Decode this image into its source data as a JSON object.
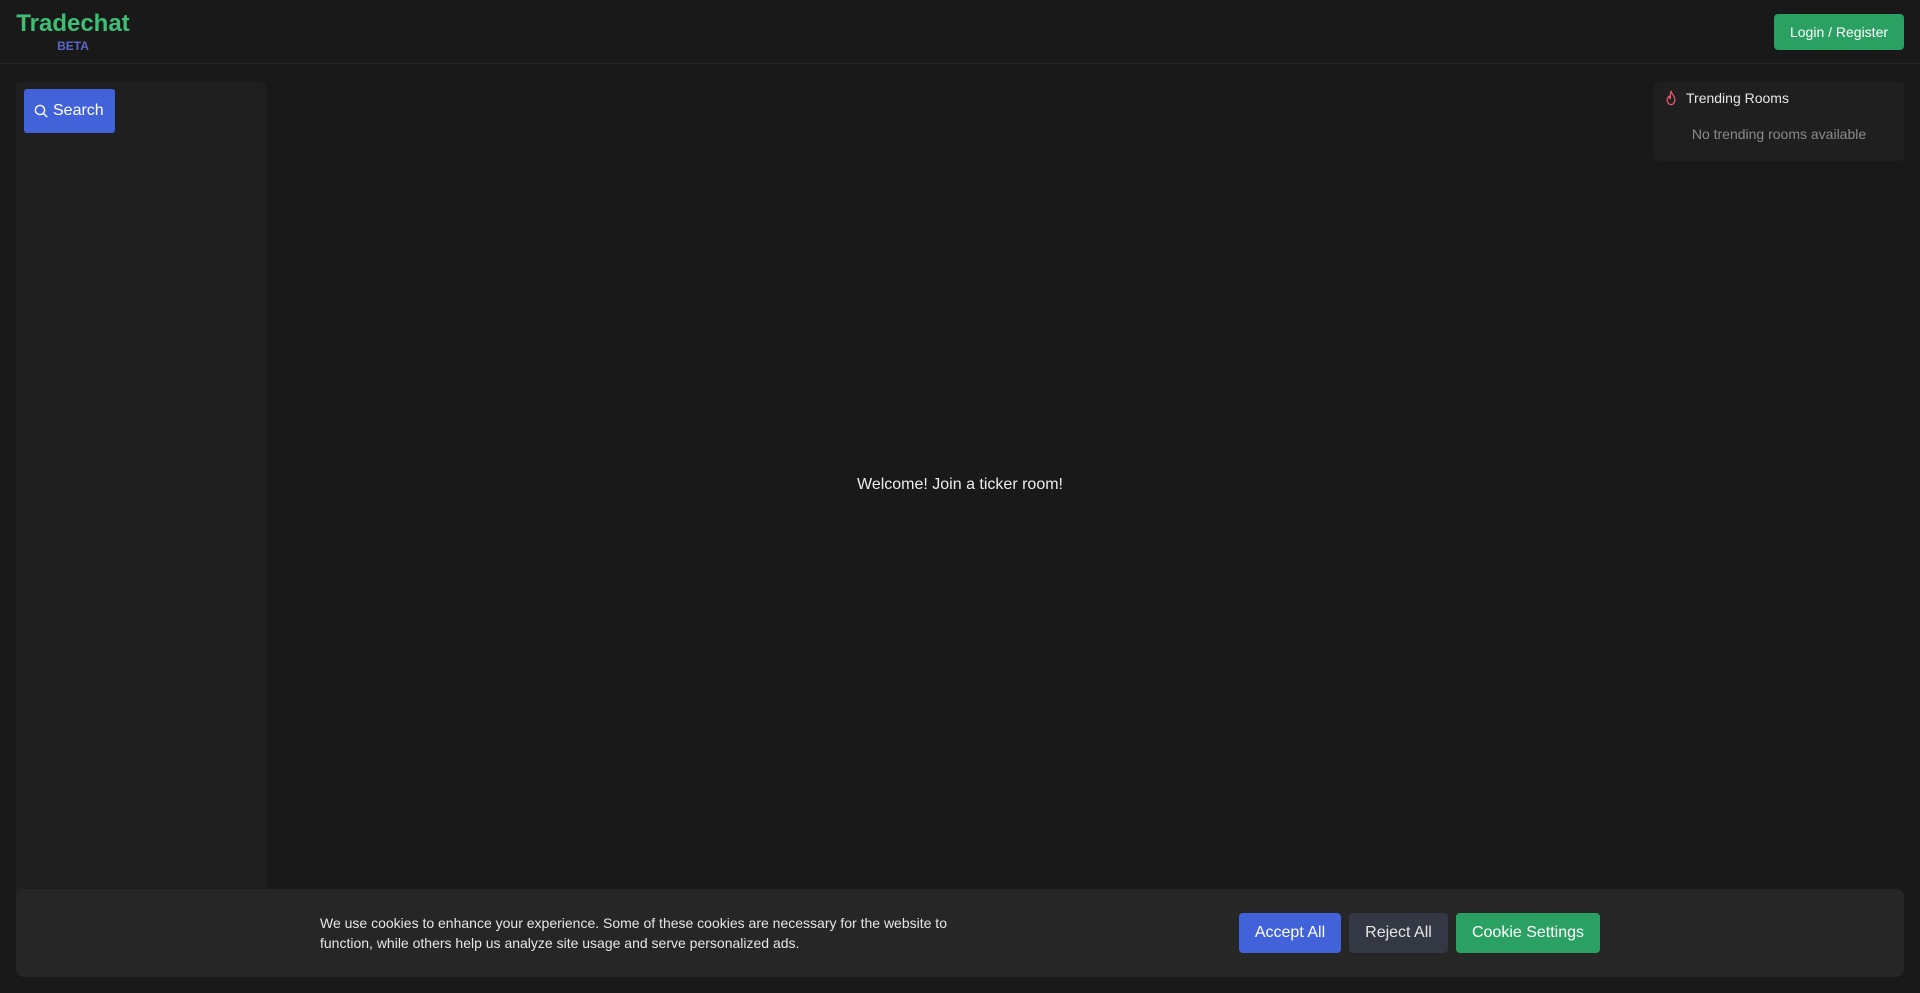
{
  "header": {
    "brand_title": "Tradechat",
    "brand_badge": "BETA",
    "login_label": "Login / Register"
  },
  "sidebar": {
    "search_label": "Search",
    "search_icon": "search-icon"
  },
  "main": {
    "welcome_text": "Welcome! Join a ticker room!"
  },
  "trending": {
    "title": "Trending Rooms",
    "icon": "flame-icon",
    "empty_text": "No trending rooms available"
  },
  "cookie_banner": {
    "message": "We use cookies to enhance your experience. Some of these cookies are necessary for the website to function, while others help us analyze site usage and serve personalized ads.",
    "accept_label": "Accept All",
    "reject_label": "Reject All",
    "settings_label": "Cookie Settings"
  },
  "colors": {
    "background": "#191919",
    "brand_green": "#3fbf74",
    "beta_indigo": "#5a67c9",
    "primary_blue": "#4262da",
    "success_green": "#2aa162",
    "flame_pink": "#e8536a"
  }
}
